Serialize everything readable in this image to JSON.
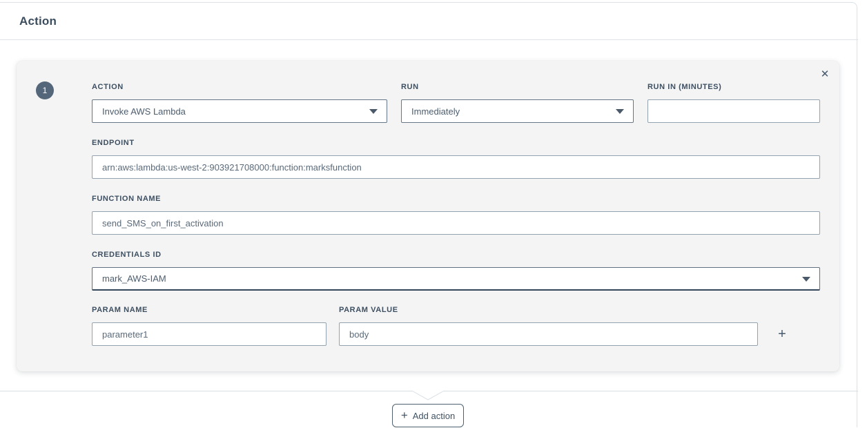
{
  "header": {
    "title": "Action"
  },
  "card": {
    "step_number": "1",
    "fields": {
      "action": {
        "label": "ACTION",
        "value": "Invoke AWS Lambda"
      },
      "run": {
        "label": "RUN",
        "value": "Immediately"
      },
      "run_in_minutes": {
        "label": "RUN IN (MINUTES)",
        "value": ""
      },
      "endpoint": {
        "label": "ENDPOINT",
        "value": "arn:aws:lambda:us-west-2:903921708000:function:marksfunction"
      },
      "function_name": {
        "label": "FUNCTION NAME",
        "value": "send_SMS_on_first_activation"
      },
      "credentials_id": {
        "label": "CREDENTIALS ID",
        "value": "mark_AWS-IAM"
      },
      "param_name": {
        "label": "PARAM NAME",
        "value": "parameter1"
      },
      "param_value": {
        "label": "PARAM VALUE",
        "value": "body"
      }
    }
  },
  "icons": {
    "close": "✕",
    "add_param": "+",
    "add_action_plus": "+"
  },
  "footer": {
    "add_action_label": "Add action"
  },
  "colors": {
    "accent_slate": "#54667a",
    "card_bg": "#f4f4f5",
    "label_text": "#3d4f61",
    "input_text": "#5a6a7a",
    "input_border": "#93a2b0",
    "select_border": "#667686",
    "divider": "#dde3e9"
  }
}
